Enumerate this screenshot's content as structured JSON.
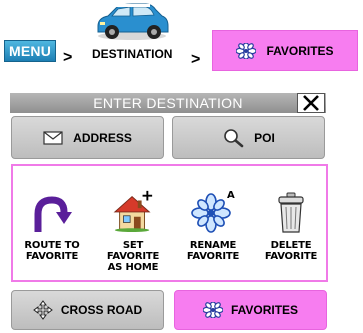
{
  "breadcrumb": {
    "menu_label": "MENU",
    "separator": ">",
    "destination_label": "DESTINATION",
    "favorites_label": "FAVORITES"
  },
  "dialog": {
    "title": "ENTER DESTINATION",
    "tabs": [
      {
        "label": "ADDRESS",
        "icon": "envelope-icon"
      },
      {
        "label": "POI",
        "icon": "magnifier-icon"
      }
    ],
    "options": [
      {
        "label": "ROUTE TO\nFAVORITE",
        "icon": "route-arrow-icon"
      },
      {
        "label": "SET\nFAVORITE\nAS HOME",
        "icon": "house-plus-icon"
      },
      {
        "label": "RENAME\nFAVORITE",
        "icon": "flower-rename-icon"
      },
      {
        "label": "DELETE\nFAVORITE",
        "icon": "trash-can-icon"
      }
    ],
    "bottom_buttons": [
      {
        "label": "CROSS ROAD",
        "icon": "cross-arrows-icon"
      },
      {
        "label": "FAVORITES",
        "icon": "flower-icon"
      }
    ]
  },
  "colors": {
    "accent_pink": "#f77df0",
    "menu_blue": "#1d7fb4",
    "titlebar_gray": "#9e9e9e"
  }
}
